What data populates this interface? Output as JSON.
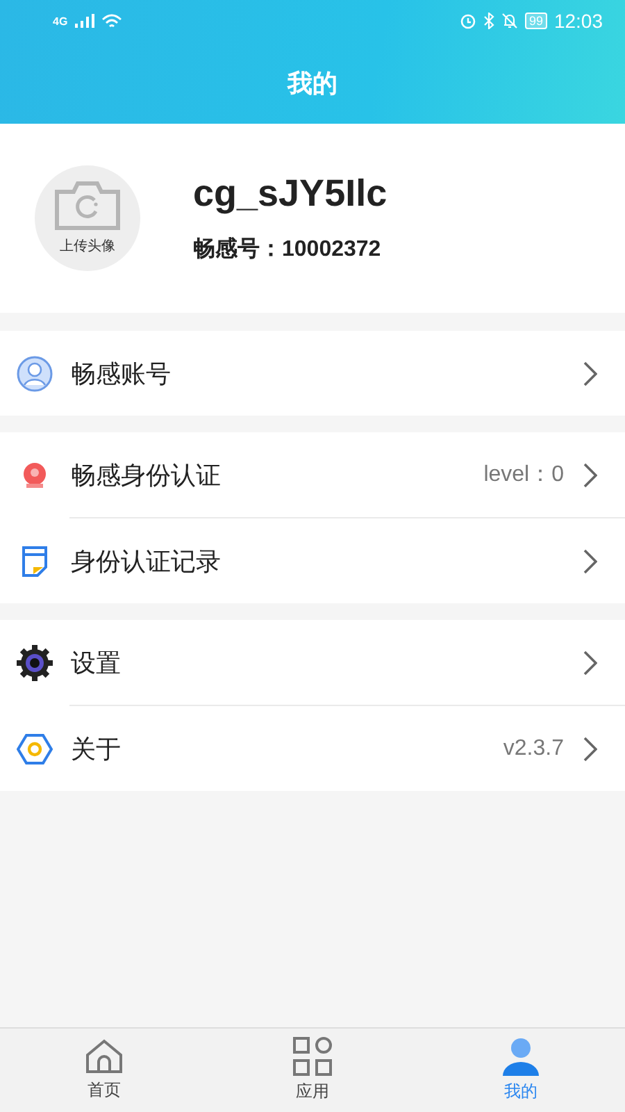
{
  "status_bar": {
    "network": "4G",
    "battery": "99",
    "time": "12:03"
  },
  "header": {
    "title": "我的"
  },
  "profile": {
    "avatar_label": "上传头像",
    "username": "cg_sJY5Ilc",
    "id_label": "畅感号：10002372"
  },
  "menu_groups": [
    {
      "items": [
        {
          "kind": "account",
          "label": "畅感账号"
        }
      ]
    },
    {
      "items": [
        {
          "kind": "badge",
          "label": "畅感身份认证",
          "value": "level：0"
        },
        {
          "kind": "record",
          "label": "身份认证记录"
        }
      ]
    },
    {
      "items": [
        {
          "kind": "settings",
          "label": "设置"
        },
        {
          "kind": "about",
          "label": "关于",
          "value": "v2.3.7"
        }
      ]
    }
  ],
  "tabs": [
    {
      "kind": "home",
      "label": "首页",
      "selected": false
    },
    {
      "kind": "apps",
      "label": "应用",
      "selected": false
    },
    {
      "kind": "me",
      "label": "我的",
      "selected": true
    }
  ]
}
